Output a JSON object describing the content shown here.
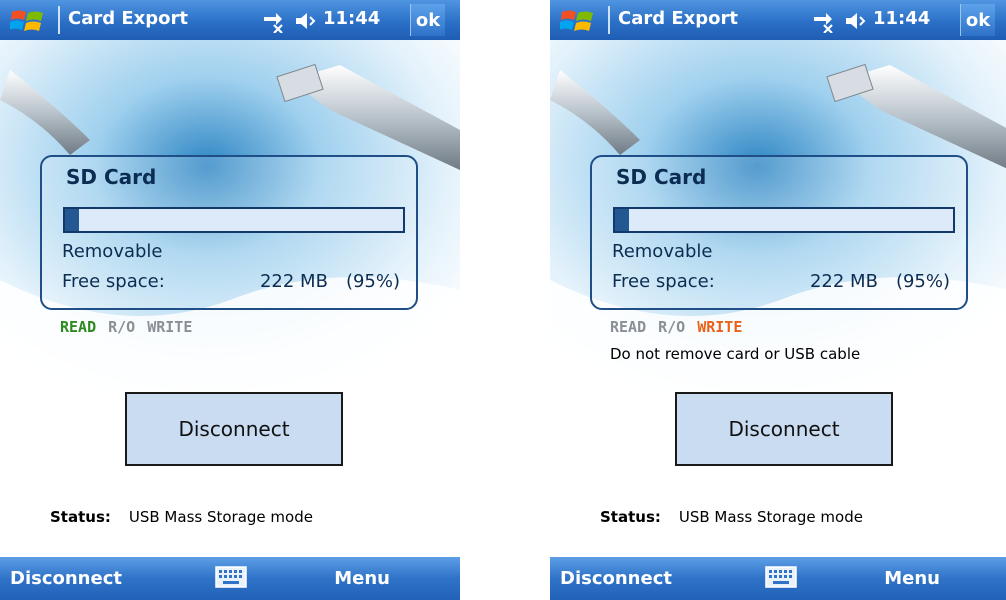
{
  "colors": {
    "title_bar": "#2b70c7",
    "soft_bar": "#2f73c8",
    "read_active": "#2d8a1e",
    "write_active": "#e8621a",
    "inactive_mode": "#8a8f96",
    "box_border": "#1f4f86",
    "button_fill": "#c9dcf2"
  },
  "screens": [
    {
      "title_bar": {
        "icon": "windows-flag-icon",
        "title": "Card Export",
        "time": "11:44",
        "ok_label": "ok",
        "status_icons": [
          "network-sync-icon",
          "volume-muted-icon"
        ]
      },
      "storage": {
        "name": "SD Card",
        "used_fraction": 0.05,
        "type": "Removable",
        "free_label": "Free space:",
        "free_value": "222 MB",
        "free_percent": "(95%)"
      },
      "modes": [
        {
          "label": "READ",
          "active": true
        },
        {
          "label": "R/O",
          "active": false
        },
        {
          "label": "WRITE",
          "active": false
        }
      ],
      "warning": "",
      "button_label": "Disconnect",
      "status_label": "Status:",
      "status_value": "USB Mass Storage mode",
      "softkeys": {
        "left": "Disconnect",
        "center_icon": "keyboard-icon",
        "right": "Menu"
      }
    },
    {
      "title_bar": {
        "icon": "windows-flag-icon",
        "title": "Card Export",
        "time": "11:44",
        "ok_label": "ok",
        "status_icons": [
          "network-sync-icon",
          "volume-muted-icon"
        ]
      },
      "storage": {
        "name": "SD Card",
        "used_fraction": 0.05,
        "type": "Removable",
        "free_label": "Free space:",
        "free_value": "222 MB",
        "free_percent": "(95%)"
      },
      "modes": [
        {
          "label": "READ",
          "active": false
        },
        {
          "label": "R/O",
          "active": false
        },
        {
          "label": "WRITE",
          "active": true
        }
      ],
      "warning": "Do not remove card or USB cable",
      "button_label": "Disconnect",
      "status_label": "Status:",
      "status_value": "USB Mass Storage mode",
      "softkeys": {
        "left": "Disconnect",
        "center_icon": "keyboard-icon",
        "right": "Menu"
      }
    }
  ]
}
